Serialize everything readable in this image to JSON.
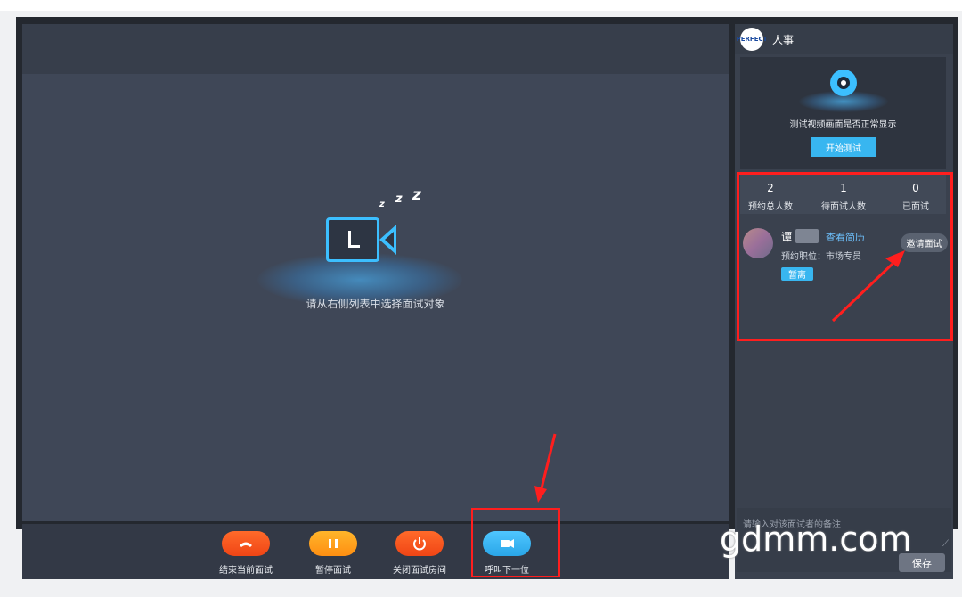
{
  "video": {
    "hint": "请从右侧列表中选择面试对象",
    "zzz": [
      "z",
      "z",
      "z"
    ]
  },
  "toolbar": {
    "buttons": [
      {
        "label": "结束当前面试",
        "color": "#ff5a1f"
      },
      {
        "label": "暂停面试",
        "color": "#ffa21a"
      },
      {
        "label": "关闭面试房间",
        "color": "#ff5a1f"
      },
      {
        "label": "呼叫下一位",
        "color": "#38b6f0"
      }
    ]
  },
  "sidebar": {
    "title": "人事",
    "logo_text": "PERFECT",
    "test": {
      "text": "测试视频画面是否正常显示",
      "button": "开始测试"
    },
    "stats": [
      {
        "value": "2",
        "label": "预约总人数"
      },
      {
        "value": "1",
        "label": "待面试人数"
      },
      {
        "value": "0",
        "label": "已面试"
      }
    ],
    "candidate": {
      "name": "谭",
      "resume_link": "查看简历",
      "position": "预约职位：市场专员",
      "status": "暂离",
      "invite": "邀请面试"
    },
    "notes": {
      "placeholder": "请输入对该面试者的备注",
      "save": "保存"
    }
  },
  "watermark": "gdmm.com",
  "colors": {
    "accent": "#38b6f0",
    "highlight": "#ff1e1e"
  }
}
